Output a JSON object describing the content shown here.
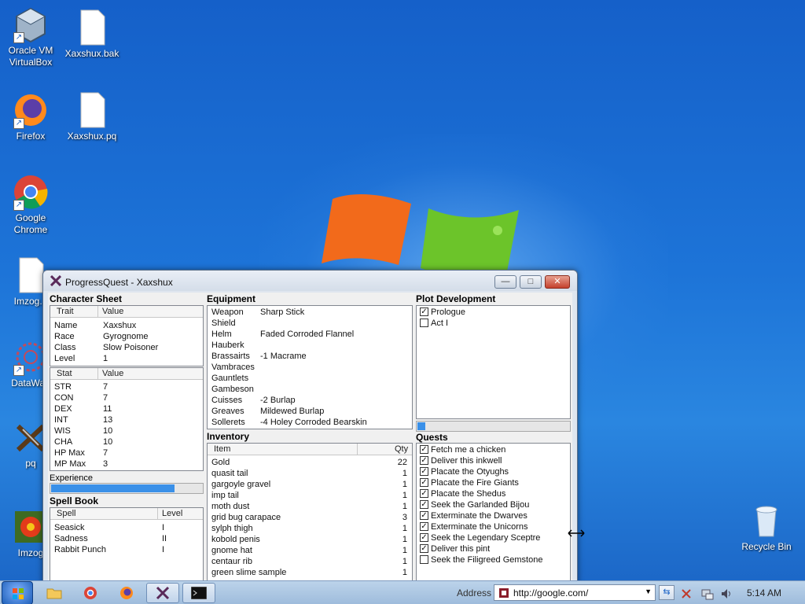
{
  "desktop": {
    "icons": [
      {
        "label": "Oracle VM VirtualBox"
      },
      {
        "label": "Xaxshux.bak"
      },
      {
        "label": "Firefox"
      },
      {
        "label": "Xaxshux.pq"
      },
      {
        "label": "Google Chrome"
      },
      {
        "label": "Imzog.p"
      },
      {
        "label": "DataWag"
      },
      {
        "label": "pq"
      },
      {
        "label": "Imzog"
      },
      {
        "label": "Recycle Bin"
      }
    ]
  },
  "window": {
    "title": "ProgressQuest - Xaxshux",
    "minimize": "—",
    "maximize": "□",
    "close": "✕"
  },
  "character_sheet": {
    "heading": "Character Sheet",
    "trait_header": "Trait",
    "value_header": "Value",
    "traits": [
      {
        "k": "Name",
        "v": "Xaxshux"
      },
      {
        "k": "Race",
        "v": "Gyrognome"
      },
      {
        "k": "Class",
        "v": "Slow Poisoner"
      },
      {
        "k": "Level",
        "v": "1"
      }
    ],
    "stat_header": "Stat",
    "stat_value_header": "Value",
    "stats": [
      {
        "k": "STR",
        "v": "7"
      },
      {
        "k": "CON",
        "v": "7"
      },
      {
        "k": "DEX",
        "v": "11"
      },
      {
        "k": "INT",
        "v": "13"
      },
      {
        "k": "WIS",
        "v": "10"
      },
      {
        "k": "CHA",
        "v": "10"
      },
      {
        "k": "HP Max",
        "v": "7"
      },
      {
        "k": "MP Max",
        "v": "3"
      }
    ],
    "experience_label": "Experience",
    "experience_progress": 0.82
  },
  "spell_book": {
    "heading": "Spell Book",
    "spell_header": "Spell",
    "level_header": "Level",
    "spells": [
      {
        "k": "Seasick",
        "v": "I"
      },
      {
        "k": "Sadness",
        "v": "II"
      },
      {
        "k": "Rabbit Punch",
        "v": "I"
      }
    ]
  },
  "equipment": {
    "heading": "Equipment",
    "items": [
      {
        "k": "Weapon",
        "v": "Sharp Stick"
      },
      {
        "k": "Shield",
        "v": ""
      },
      {
        "k": "Helm",
        "v": "Faded Corroded Flannel"
      },
      {
        "k": "Hauberk",
        "v": ""
      },
      {
        "k": "Brassairts",
        "v": "-1 Macrame"
      },
      {
        "k": "Vambraces",
        "v": ""
      },
      {
        "k": "Gauntlets",
        "v": ""
      },
      {
        "k": "Gambeson",
        "v": ""
      },
      {
        "k": "Cuisses",
        "v": "-2 Burlap"
      },
      {
        "k": "Greaves",
        "v": "Mildewed Burlap"
      },
      {
        "k": "Sollerets",
        "v": "-4 Holey Corroded Bearskin"
      }
    ]
  },
  "inventory": {
    "heading": "Inventory",
    "item_header": "Item",
    "qty_header": "Qty",
    "items": [
      {
        "k": "Gold",
        "v": "22"
      },
      {
        "k": "quasit tail",
        "v": "1"
      },
      {
        "k": "gargoyle gravel",
        "v": "1"
      },
      {
        "k": "imp tail",
        "v": "1"
      },
      {
        "k": "moth dust",
        "v": "1"
      },
      {
        "k": "grid bug carapace",
        "v": "3"
      },
      {
        "k": "sylph thigh",
        "v": "1"
      },
      {
        "k": "kobold penis",
        "v": "1"
      },
      {
        "k": "gnome hat",
        "v": "1"
      },
      {
        "k": "centaur rib",
        "v": "1"
      },
      {
        "k": "green slime sample",
        "v": "1"
      }
    ]
  },
  "plot": {
    "heading": "Plot Development",
    "acts": [
      {
        "label": "Prologue",
        "done": "✓"
      },
      {
        "label": "Act I",
        "done": ""
      }
    ],
    "progress": 0.05
  },
  "quests": {
    "heading": "Quests",
    "items": [
      {
        "label": "Fetch me a chicken",
        "done": "✓"
      },
      {
        "label": "Deliver this inkwell",
        "done": "✓"
      },
      {
        "label": "Placate the Otyughs",
        "done": "✓"
      },
      {
        "label": "Placate the Fire Giants",
        "done": "✓"
      },
      {
        "label": "Placate the Shedus",
        "done": "✓"
      },
      {
        "label": "Seek the Garlanded Bijou",
        "done": "✓"
      },
      {
        "label": "Exterminate the Dwarves",
        "done": "✓"
      },
      {
        "label": "Exterminate the Unicorns",
        "done": "✓"
      },
      {
        "label": "Seek the Legendary Sceptre",
        "done": "✓"
      },
      {
        "label": "Deliver this pint",
        "done": "✓"
      },
      {
        "label": "Seek the Filigreed Gemstone",
        "done": ""
      }
    ]
  },
  "taskbar": {
    "address_label": "Address",
    "address_value": "http://google.com/",
    "clock": "5:14 AM"
  }
}
